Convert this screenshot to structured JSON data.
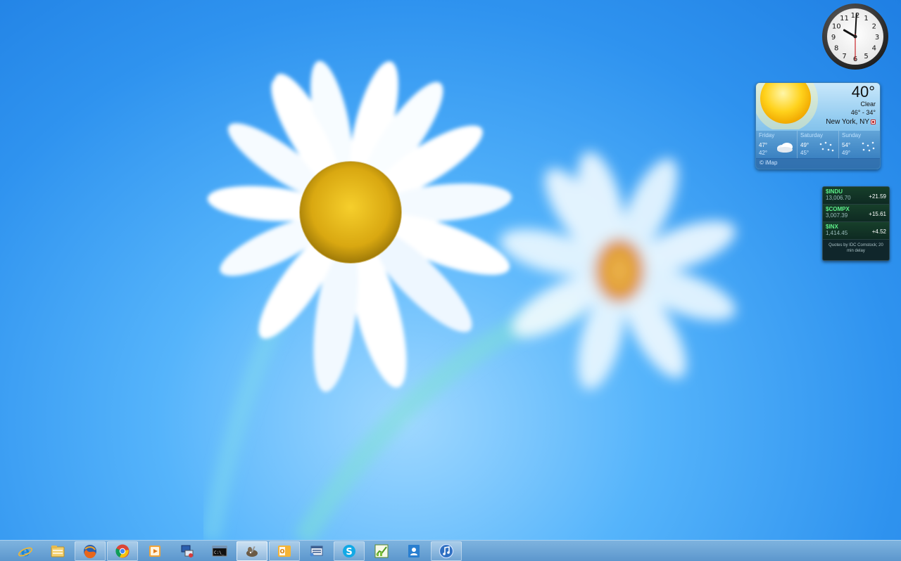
{
  "clock": {
    "numerals": [
      "12",
      "1",
      "2",
      "3",
      "4",
      "5",
      "6",
      "7",
      "8",
      "9",
      "10",
      "11"
    ],
    "time_hour": 10,
    "time_minute": 0,
    "time_second": 30
  },
  "weather": {
    "temperature": "40°",
    "condition": "Clear",
    "range": "46° - 34°",
    "city": "New York, NY",
    "forecast": [
      {
        "day": "Friday",
        "high": "47°",
        "low": "42°",
        "icon": "cloudy-icon"
      },
      {
        "day": "Saturday",
        "high": "49°",
        "low": "45°",
        "icon": "snow-icon"
      },
      {
        "day": "Sunday",
        "high": "54°",
        "low": "49°",
        "icon": "snow-icon"
      }
    ],
    "credit": "© iMap"
  },
  "stocks": {
    "rows": [
      {
        "symbol": "$INDU",
        "value": "13,006.70",
        "change": "+21.59"
      },
      {
        "symbol": "$COMPX",
        "value": "3,007.39",
        "change": "+15.61"
      },
      {
        "symbol": "$INX",
        "value": "1,414.45",
        "change": "+4.52"
      }
    ],
    "note": "Quotes by IDC Comstock; 20 min delay"
  },
  "taskbar": {
    "items": [
      {
        "name": "internet-explorer",
        "state": "pinned"
      },
      {
        "name": "file-explorer",
        "state": "pinned"
      },
      {
        "name": "firefox",
        "state": "running"
      },
      {
        "name": "chrome",
        "state": "running"
      },
      {
        "name": "media-player",
        "state": "pinned"
      },
      {
        "name": "remote-desktop",
        "state": "pinned"
      },
      {
        "name": "command-prompt",
        "state": "pinned"
      },
      {
        "name": "gimp",
        "state": "active"
      },
      {
        "name": "outlook",
        "state": "running"
      },
      {
        "name": "network-tool",
        "state": "pinned"
      },
      {
        "name": "skype",
        "state": "running"
      },
      {
        "name": "stats-app",
        "state": "pinned"
      },
      {
        "name": "contacts",
        "state": "pinned"
      },
      {
        "name": "itunes",
        "state": "running"
      }
    ]
  },
  "colors": {
    "desktop": "#2f93ef",
    "taskbar": "#5c97cd",
    "stock_symbol": "#5ef08a"
  }
}
